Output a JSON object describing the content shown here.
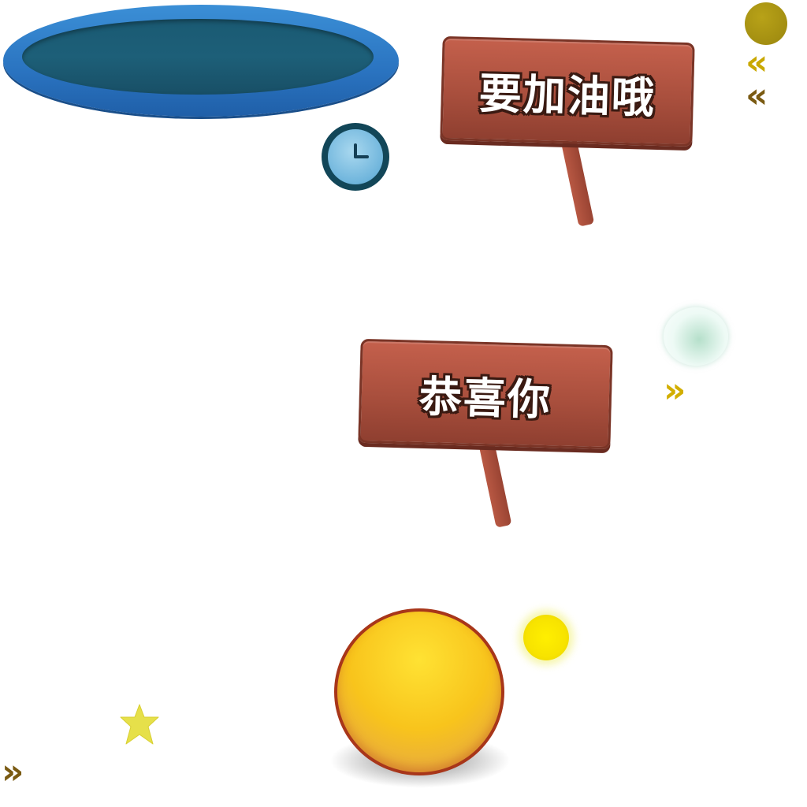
{
  "signs": [
    {
      "text": "要加油哦"
    },
    {
      "text": "恭喜你"
    }
  ],
  "icons": {
    "clock": "clock-icon",
    "chevron_left": "«",
    "chevron_right": "»"
  },
  "colors": {
    "panel_blue": "#2a73c0",
    "panel_inner": "#1d5f78",
    "sign_wood": "#a94f3d",
    "button_yellow": "#f8c41c",
    "chevron_gold": "#c9a800",
    "chevron_brown": "#7a5a12"
  }
}
